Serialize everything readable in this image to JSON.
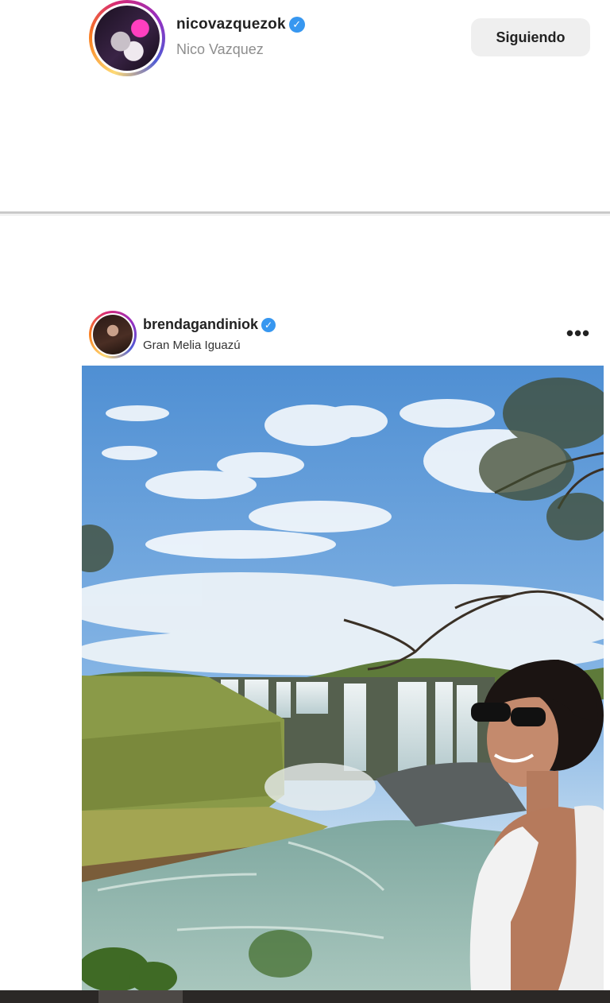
{
  "suggested_profile": {
    "username": "nicovazquezok",
    "full_name": "Nico Vazquez",
    "verified": true,
    "follow_button_label": "Siguiendo"
  },
  "post": {
    "username": "brendagandiniok",
    "verified": true,
    "location": "Gran Melia Iguazú",
    "more_icon": "•••",
    "photo_icon": "photo-waterfall-selfie"
  },
  "icons": {
    "verified_glyph": "✓"
  },
  "colors": {
    "verified_blue": "#3797f0",
    "button_bg": "#efefef",
    "secondary_text": "#8e8e8e"
  }
}
